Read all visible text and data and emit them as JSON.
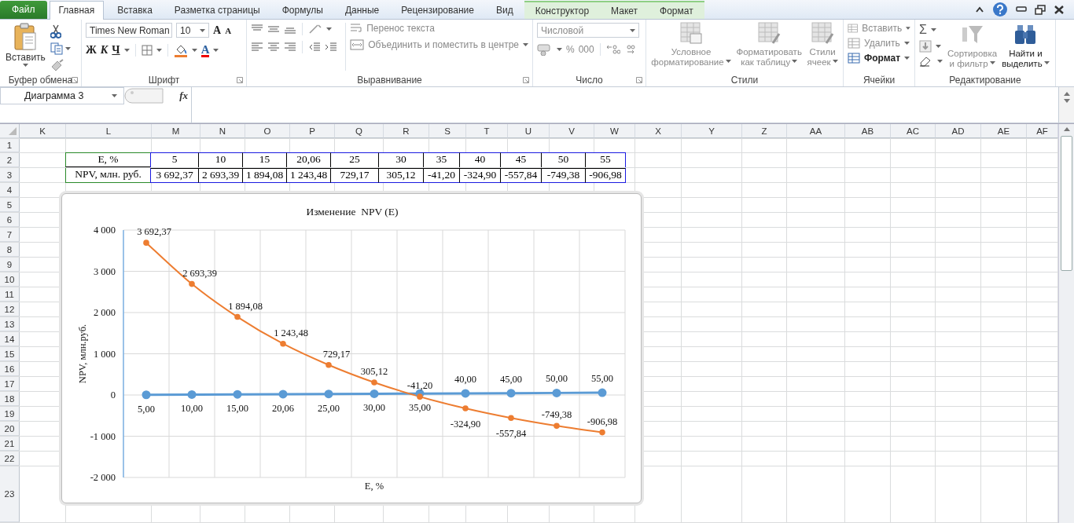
{
  "tabs": [
    {
      "label": "Файл",
      "kind": "file",
      "selected": false
    },
    {
      "label": "Главная",
      "kind": "normal",
      "selected": true
    },
    {
      "label": "Вставка",
      "kind": "normal",
      "selected": false
    },
    {
      "label": "Разметка страницы",
      "kind": "normal",
      "selected": false
    },
    {
      "label": "Формулы",
      "kind": "normal",
      "selected": false
    },
    {
      "label": "Данные",
      "kind": "normal",
      "selected": false
    },
    {
      "label": "Рецензирование",
      "kind": "normal",
      "selected": false
    },
    {
      "label": "Вид",
      "kind": "normal",
      "selected": false
    },
    {
      "label": "Конструктор",
      "kind": "context",
      "selected": false
    },
    {
      "label": "Макет",
      "kind": "context",
      "selected": false
    },
    {
      "label": "Формат",
      "kind": "context",
      "selected": false
    }
  ],
  "ribbon": {
    "clipboard": {
      "label": "Буфер обмена",
      "paste": "Вставить"
    },
    "font": {
      "label": "Шрифт",
      "name": "Times New Roman",
      "size": "10",
      "grow": "A",
      "shrink": "A",
      "bold": "Ж",
      "italic": "К",
      "underline": "Ч",
      "color_letter": "A"
    },
    "alignment": {
      "label": "Выравнивание",
      "wrap": {
        "label": "Перенос текста",
        "disabled": true
      },
      "merge": {
        "label": "Объединить и поместить в центре",
        "disabled": true
      }
    },
    "number": {
      "label": "Число",
      "format": {
        "value": "Числовой",
        "disabled": true
      },
      "percent": "%",
      "thousands": "000"
    },
    "styles": {
      "label": "Стили",
      "buttons": [
        {
          "lines": [
            "Условное",
            "форматирование"
          ],
          "disabled": true
        },
        {
          "lines": [
            "Форматировать",
            "как таблицу"
          ],
          "disabled": true
        },
        {
          "lines": [
            "Стили",
            "ячеек"
          ],
          "disabled": true
        }
      ]
    },
    "cells": {
      "label": "Ячейки",
      "items": [
        {
          "label": "Вставить",
          "disabled": true
        },
        {
          "label": "Удалить",
          "disabled": true
        },
        {
          "label": "Формат",
          "disabled": false
        }
      ]
    },
    "editing": {
      "label": "Редактирование",
      "sum": "Σ",
      "sort": {
        "lines": [
          "Сортировка",
          "и фильтр"
        ],
        "disabled": true
      },
      "find": {
        "lines": [
          "Найти и",
          "выделить"
        ],
        "disabled": false
      }
    }
  },
  "formula_bar": {
    "name_box": "Диаграмма 3",
    "fx": "fx"
  },
  "sheet": {
    "columns": [
      "K",
      "L",
      "M",
      "N",
      "O",
      "P",
      "Q",
      "R",
      "S",
      "T",
      "U",
      "V",
      "W",
      "X",
      "Y",
      "Z",
      "AA",
      "AB",
      "AC",
      "AD",
      "AE",
      "AF"
    ],
    "rows": [
      "1",
      "2",
      "3",
      "4",
      "5",
      "6",
      "7",
      "8",
      "9",
      "10",
      "11",
      "12",
      "13",
      "14",
      "15",
      "16",
      "17",
      "18",
      "19",
      "20",
      "21",
      "22",
      "23"
    ],
    "table": [
      {
        "cells": [
          "E, %",
          "5",
          "10",
          "15",
          "20,06",
          "25",
          "30",
          "35",
          "40",
          "45",
          "50",
          "55"
        ]
      },
      {
        "cells": [
          "NPV, млн. руб.",
          "3 692,37",
          "2 693,39",
          "1 894,08",
          "1 243,48",
          "729,17",
          "305,12",
          "-41,20",
          "-324,90",
          "-557,84",
          "-749,38",
          "-906,98"
        ]
      }
    ],
    "chart_data": {
      "type": "line",
      "title": "Изменение  NPV (E)",
      "xlabel": "E, %",
      "ylabel": "NPV, млн.руб.",
      "ylim": [
        -2000,
        4000
      ],
      "yticks": [
        {
          "value": 4000,
          "label": "4 000"
        },
        {
          "value": 3000,
          "label": "3 000"
        },
        {
          "value": 2000,
          "label": "2 000"
        },
        {
          "value": 1000,
          "label": "1 000"
        },
        {
          "value": 0,
          "label": "0"
        },
        {
          "value": -1000,
          "label": "-1 000"
        },
        {
          "value": -2000,
          "label": "-2 000"
        }
      ],
      "grid": true,
      "series": [
        {
          "color": "#5b9bd5",
          "marker": "circle",
          "values": [
            5,
            10,
            15,
            20.06,
            25,
            30,
            35,
            40,
            45,
            50,
            55
          ],
          "value_labels": [
            "5,00",
            "10,00",
            "15,00",
            "20,06",
            "25,00",
            "30,00",
            "35,00",
            "40,00",
            "45,00",
            "50,00",
            "55,00"
          ]
        },
        {
          "color": "#ed7d31",
          "marker": "circle",
          "values": [
            3692.37,
            2693.39,
            1894.08,
            1243.48,
            729.17,
            305.12,
            -41.2,
            -324.9,
            -557.84,
            -749.38,
            -906.98
          ],
          "value_labels": [
            "3 692,37",
            "2 693,39",
            "1 894,08",
            "1 243,48",
            "729,17",
            "305,12",
            "-41,20",
            "-324,90",
            "-557,84",
            "-749,38",
            "-906,98"
          ]
        }
      ]
    }
  }
}
